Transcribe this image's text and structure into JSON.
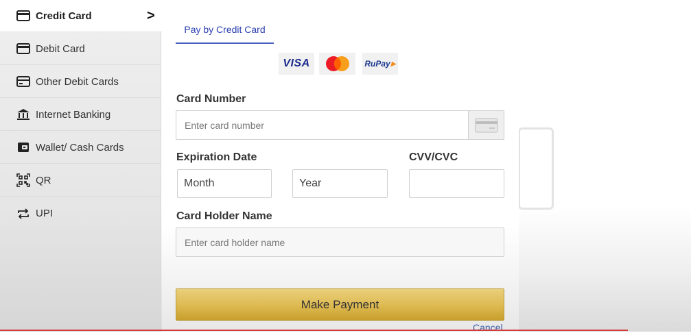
{
  "sidebar": {
    "items": [
      {
        "label": "Credit Card",
        "icon": "credit-card-icon",
        "active": true
      },
      {
        "label": "Debit Card",
        "icon": "debit-card-icon"
      },
      {
        "label": "Other Debit Cards",
        "icon": "other-debit-card-icon"
      },
      {
        "label": "Internet Banking",
        "icon": "bank-icon"
      },
      {
        "label": "Wallet/ Cash Cards",
        "icon": "wallet-icon"
      },
      {
        "label": "QR",
        "icon": "qr-icon"
      },
      {
        "label": "UPI",
        "icon": "upi-icon"
      }
    ],
    "active_chevron": ">"
  },
  "main": {
    "tab_label": "Pay by Credit Card",
    "logos": {
      "visa": "VISA",
      "mastercard": "mastercard-logo",
      "rupay": "RuPay"
    },
    "card_number_label": "Card Number",
    "card_number_placeholder": "Enter card number",
    "expiration_label": "Expiration Date",
    "month_value": "Month",
    "year_value": "Year",
    "cvv_label": "CVV/CVC",
    "holder_label": "Card Holder Name",
    "holder_placeholder": "Enter card holder name",
    "pay_button": "Make Payment",
    "cancel": "Cancel"
  },
  "colors": {
    "accent": "#2b3fb0",
    "button": "#ddb950",
    "link": "#3d5fa8"
  }
}
